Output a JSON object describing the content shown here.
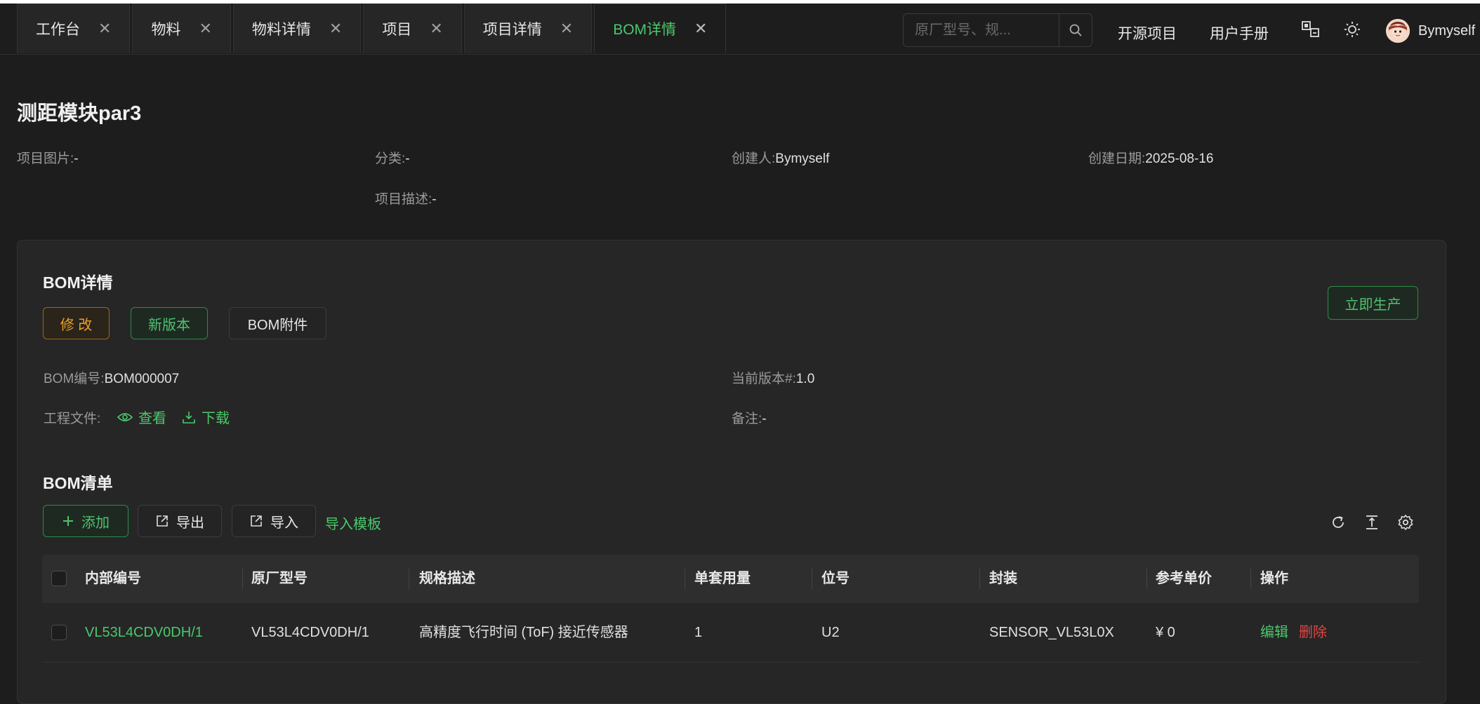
{
  "tabs": [
    {
      "label": "工作台",
      "active": false
    },
    {
      "label": "物料",
      "active": false
    },
    {
      "label": "物料详情",
      "active": false
    },
    {
      "label": "项目",
      "active": false
    },
    {
      "label": "项目详情",
      "active": false
    },
    {
      "label": "BOM详情",
      "active": true
    }
  ],
  "header": {
    "search_placeholder": "原厂型号、规...",
    "open_source_link": "开源项目",
    "manual_link": "用户手册",
    "username": "Bymyself"
  },
  "project": {
    "title": "测距模块par3",
    "image_label": "项目图片:",
    "image_value": "-",
    "category_label": "分类:",
    "category_value": "-",
    "creator_label": "创建人:",
    "creator_value": "Bymyself",
    "date_label": "创建日期:",
    "date_value": "2025-08-16",
    "desc_label": "项目描述:",
    "desc_value": "-"
  },
  "bom": {
    "section_title": "BOM详情",
    "modify_btn": "修 改",
    "new_version_btn": "新版本",
    "attachment_btn": "BOM附件",
    "produce_btn": "立即生产",
    "number_label": "BOM编号:",
    "number_value": "BOM000007",
    "version_label": "当前版本#:",
    "version_value": "1.0",
    "files_label": "工程文件:",
    "view_link": "查看",
    "download_link": "下载",
    "remark_label": "备注:",
    "remark_value": "-"
  },
  "list": {
    "title": "BOM清单",
    "add_btn": "添加",
    "export_btn": "导出",
    "import_btn": "导入",
    "template_link": "导入模板",
    "columns": [
      "内部编号",
      "原厂型号",
      "规格描述",
      "单套用量",
      "位号",
      "封装",
      "参考单价",
      "操作"
    ],
    "rows": [
      {
        "code": "VL53L4CDV0DH/1",
        "model": "VL53L4CDV0DH/1",
        "spec": "高精度飞行时间 (ToF) 接近传感器",
        "qty": "1",
        "ref": "U2",
        "package": "SENSOR_VL53L0X",
        "price": "¥ 0",
        "edit": "编辑",
        "delete": "删除"
      }
    ]
  },
  "colors": {
    "accent": "#49c96a",
    "warning": "#e8a02a",
    "danger": "#e04545"
  }
}
